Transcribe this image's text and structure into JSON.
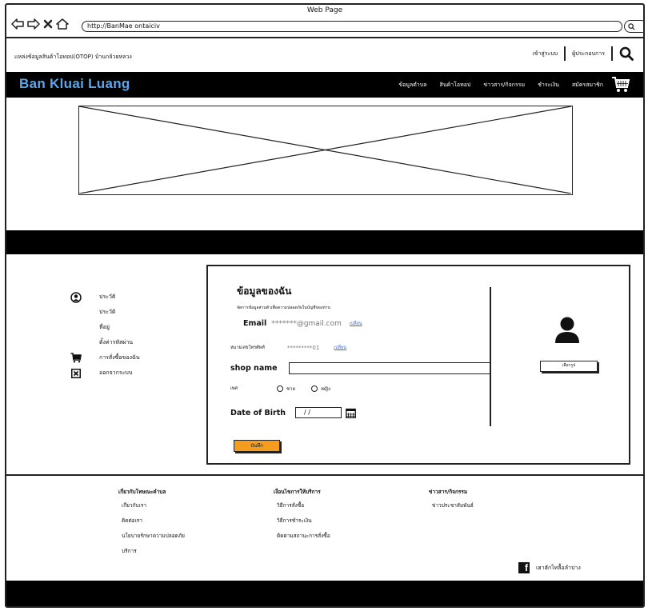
{
  "browser": {
    "window_title": "Web Page",
    "url": "http://BanMae ontaiciv"
  },
  "infobar": {
    "site_description": "แหล่งข้อมูลสินค้าโอทอป(OTOP) บ้านกล้วยหลวง",
    "login_label": "เข้าสู่ระบบ",
    "operator_label": "ผู้ประกอบการ"
  },
  "nav": {
    "brand": "Ban Kluai Luang",
    "brand_color": "#5aa7ee",
    "menu": [
      "ข้อมูลตำบล",
      "สินค้าโอทอป",
      "ข่าวสาร/กิจกรรม",
      "ชำระเงิน",
      "สมัครสมาชิก"
    ]
  },
  "sidebar": {
    "items": [
      {
        "label": "ประวัติ",
        "icon": "user-circle-icon"
      },
      {
        "label": "ประวัติ",
        "icon": ""
      },
      {
        "label": "ที่อยู่",
        "icon": ""
      },
      {
        "label": "ตั้งค่ารหัสผ่าน",
        "icon": ""
      },
      {
        "label": "การสั่งซื้อของฉัน",
        "icon": "cart-icon"
      },
      {
        "label": "ออกจากระบบ",
        "icon": "close-box-icon"
      }
    ]
  },
  "profile": {
    "title": "ข้อมูลของฉัน",
    "subtitle": "จัดการข้อมูลส่วนตัวเพื่อความปลอดภัยในบัญชีของท่าน",
    "email_label": "Email",
    "email_value": "*******@gmail.com",
    "email_change": "เปลี่ยน",
    "phone_label": "หมายเลขโทรศัพท์",
    "phone_value": "*********01",
    "phone_change": "เปลี่ยน",
    "shop_label": "shop name",
    "gender_label": "เพศ",
    "gender_options": [
      "ชาย",
      "หญิง"
    ],
    "dob_label": "Date of Birth",
    "dob_value": "/ /",
    "save_label": "บันทึก",
    "save_color": "#f39c20",
    "pick_image_label": "เลือกรูป"
  },
  "footer": {
    "col1": {
      "heading": "เกี่ยวกับโทษณะคำบล",
      "items": [
        "เกี่ยวกับเรา",
        "ติดต่อเรา",
        "นโยบายรักษาความปลอดภัย",
        "บริการ"
      ]
    },
    "col2": {
      "heading": "เงื่อนไขการให้บริการ",
      "items": [
        "วิธีการสั่งซื้อ",
        "วิธีการชำระเงิน",
        "ติดตามสถานะการสั่งซื้อ"
      ]
    },
    "col3": {
      "heading": "ข่าวสาร/กิจกรรม",
      "items": [
        "ข่าวประชาสัมพันธ์"
      ]
    },
    "social_label": "เฮาฮักไทลื้อลำปาง"
  }
}
